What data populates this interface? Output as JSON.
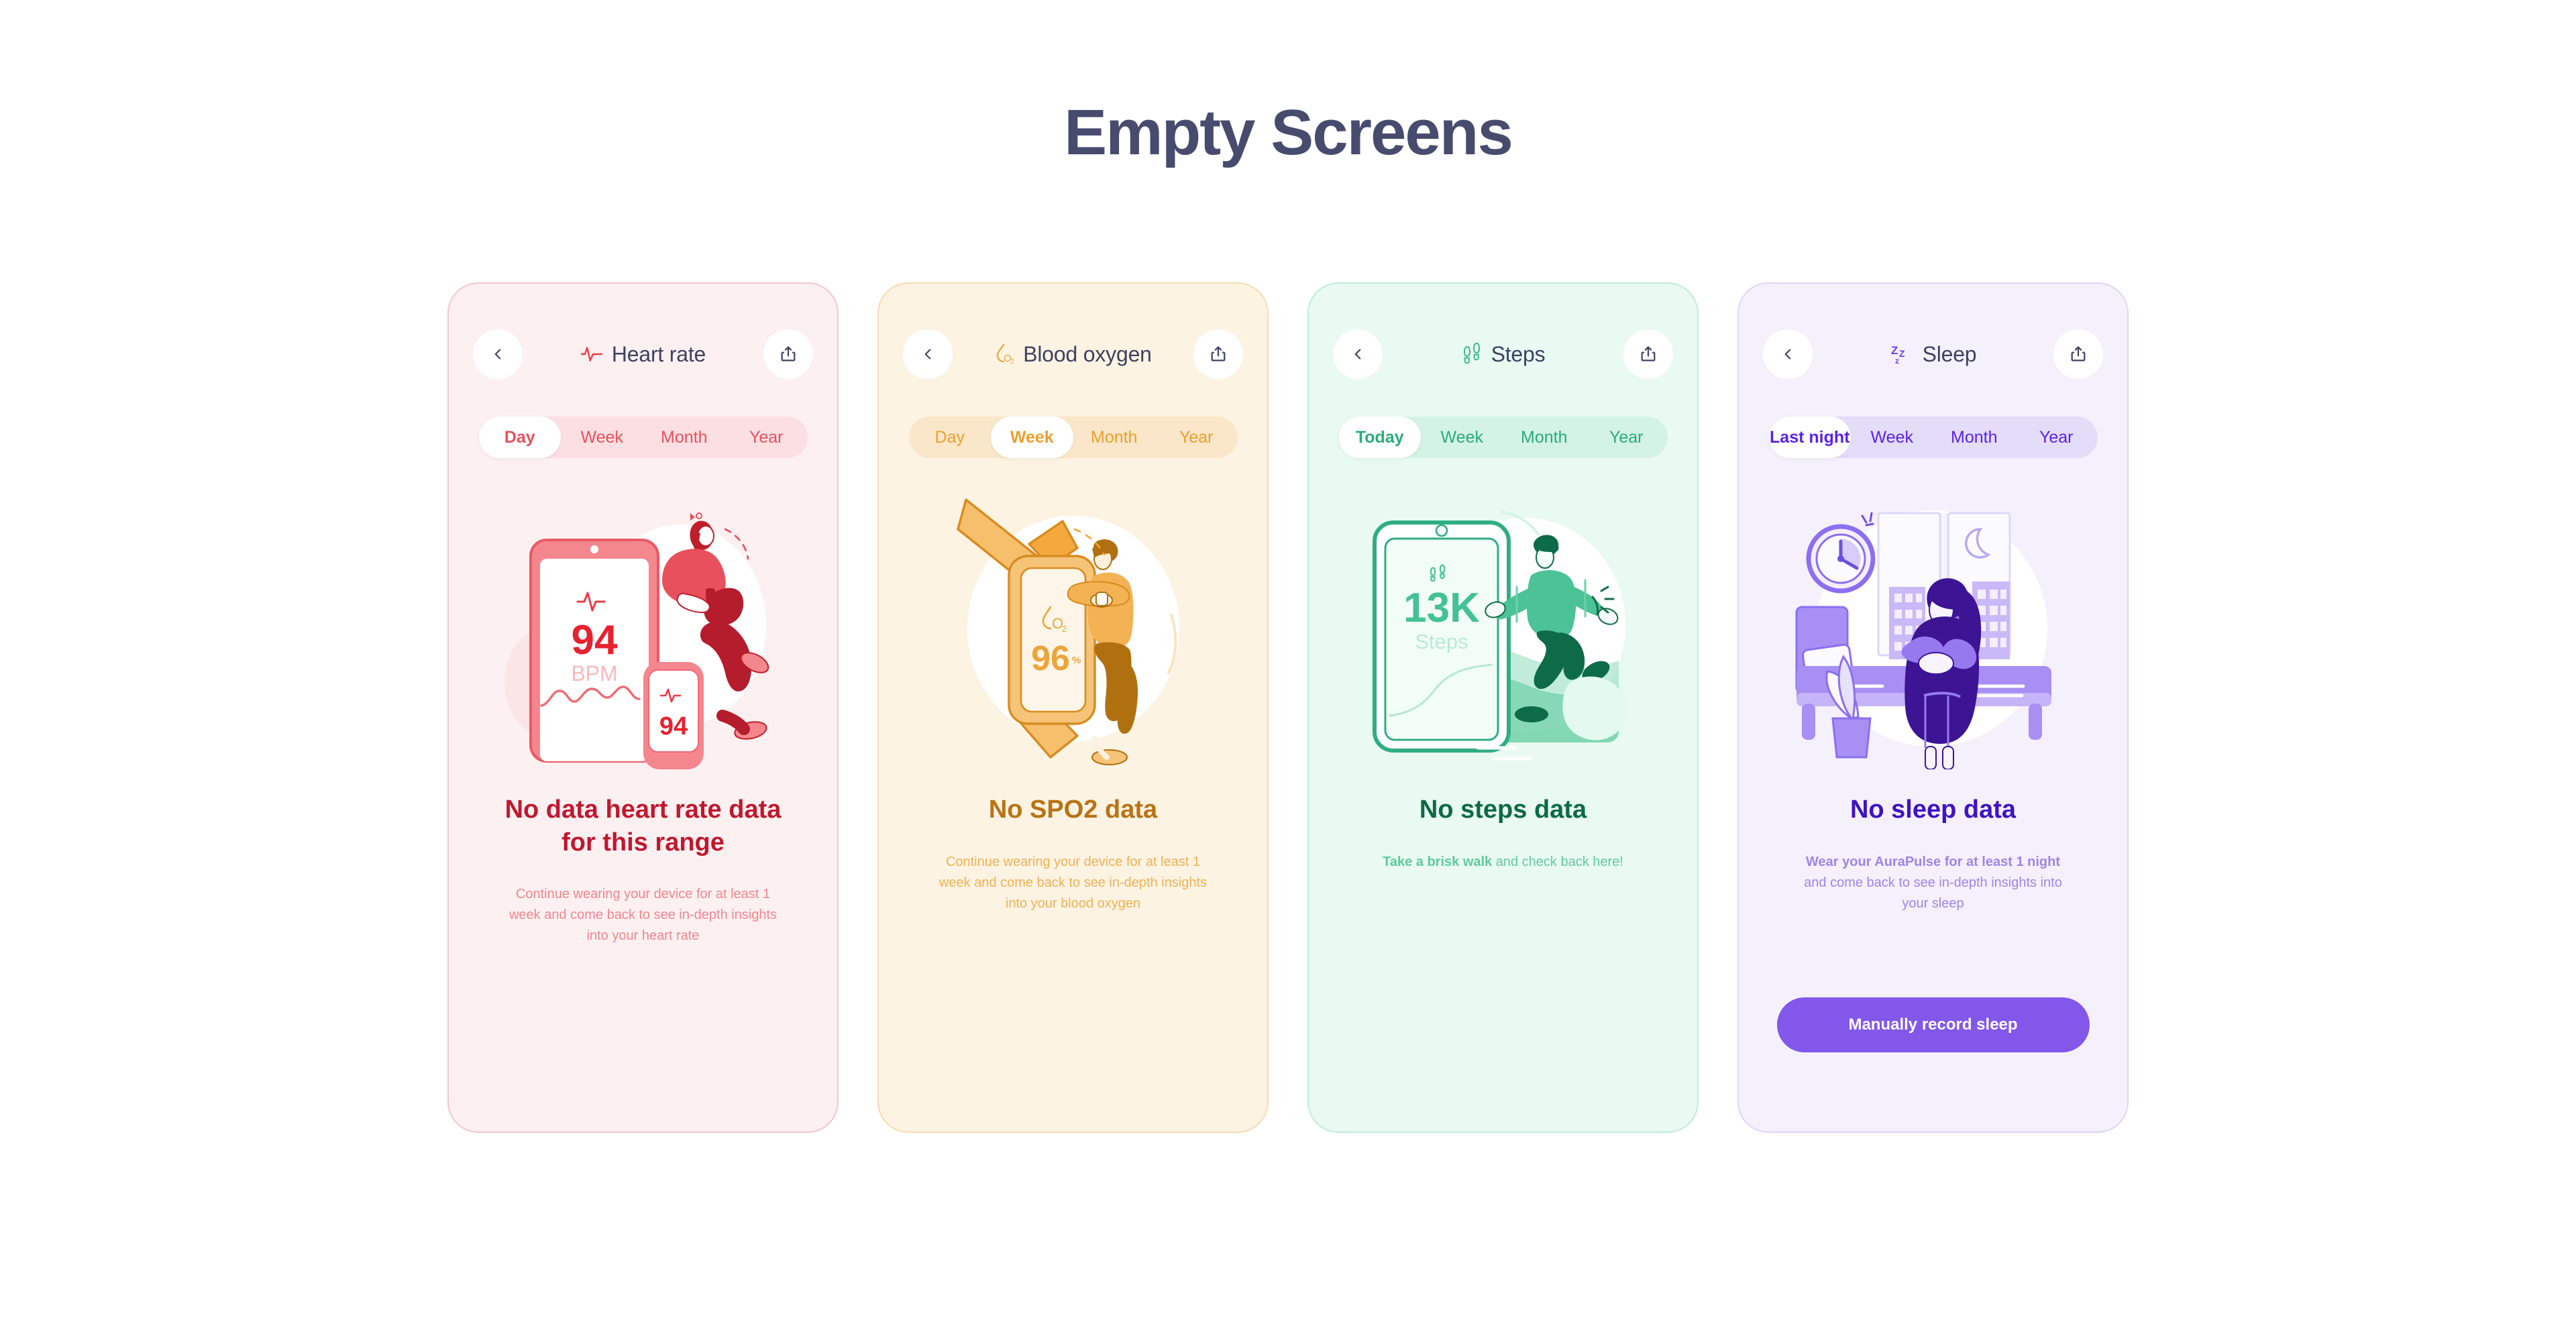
{
  "page": {
    "title": "Empty Screens"
  },
  "theme": {
    "title_color": "#474c6e",
    "heart_rate": "#e8505b",
    "blood_oxygen": "#eca02c",
    "steps": "#2bab7b",
    "sleep": "#5b22e8",
    "cta_purple": "#8257ea"
  },
  "cards": [
    {
      "id": "heart-rate",
      "header": {
        "back_icon": "chevron-left-icon",
        "title": "Heart rate",
        "title_icon": "heartbeat-pulse-icon",
        "share_icon": "share-upload-icon"
      },
      "tabs": [
        {
          "label": "Day",
          "active": true
        },
        {
          "label": "Week",
          "active": false
        },
        {
          "label": "Month",
          "active": false
        },
        {
          "label": "Year",
          "active": false
        }
      ],
      "illustration": {
        "name": "woman-sitting-on-phone-and-watch-illustration",
        "phone_value": "94",
        "phone_unit": "BPM",
        "watch_value": "94"
      },
      "headline": "No data heart rate data for this range",
      "subtext_bold": "",
      "subtext": "Continue wearing your device for at least 1 week and come back to see in-depth insights into your heart rate",
      "cta": null
    },
    {
      "id": "blood-oxygen",
      "header": {
        "back_icon": "chevron-left-icon",
        "title": "Blood oxygen",
        "title_icon": "o2-droplet-icon",
        "share_icon": "share-upload-icon"
      },
      "tabs": [
        {
          "label": "Day",
          "active": false
        },
        {
          "label": "Week",
          "active": true
        },
        {
          "label": "Month",
          "active": false
        },
        {
          "label": "Year",
          "active": false
        }
      ],
      "illustration": {
        "name": "man-leaning-on-giant-smartwatch-illustration",
        "watch_value": "96",
        "watch_unit": "%",
        "watch_icon": "o2-droplet-icon"
      },
      "headline": "No SPO2 data",
      "subtext_bold": "",
      "subtext": "Continue wearing your device for at least 1 week and come back to see in-depth insights into your blood oxygen",
      "cta": null
    },
    {
      "id": "steps",
      "header": {
        "back_icon": "chevron-left-icon",
        "title": "Steps",
        "title_icon": "footprints-icon",
        "share_icon": "share-upload-icon"
      },
      "tabs": [
        {
          "label": "Today",
          "active": true
        },
        {
          "label": "Week",
          "active": false
        },
        {
          "label": "Month",
          "active": false
        },
        {
          "label": "Year",
          "active": false
        }
      ],
      "illustration": {
        "name": "running-man-beside-phone-illustration",
        "phone_value": "13K",
        "phone_unit": "Steps",
        "phone_icon": "footprints-icon"
      },
      "headline": "No steps data",
      "subtext_bold": "Take a brisk walk",
      "subtext": " and check back here!",
      "cta": null
    },
    {
      "id": "sleep",
      "header": {
        "back_icon": "chevron-left-icon",
        "title": "Sleep",
        "title_icon": "zzz-sleep-icon",
        "share_icon": "share-upload-icon"
      },
      "tabs": [
        {
          "label": "Last night",
          "active": true
        },
        {
          "label": "Week",
          "active": false
        },
        {
          "label": "Month",
          "active": false
        },
        {
          "label": "Year",
          "active": false
        }
      ],
      "illustration": {
        "name": "woman-sitting-by-bed-at-night-illustration"
      },
      "headline": "No sleep data",
      "subtext_bold": "Wear your AuraPulse for at least 1 night",
      "subtext": " and come back to see in-depth insights into your sleep",
      "cta": "Manually record sleep"
    }
  ]
}
